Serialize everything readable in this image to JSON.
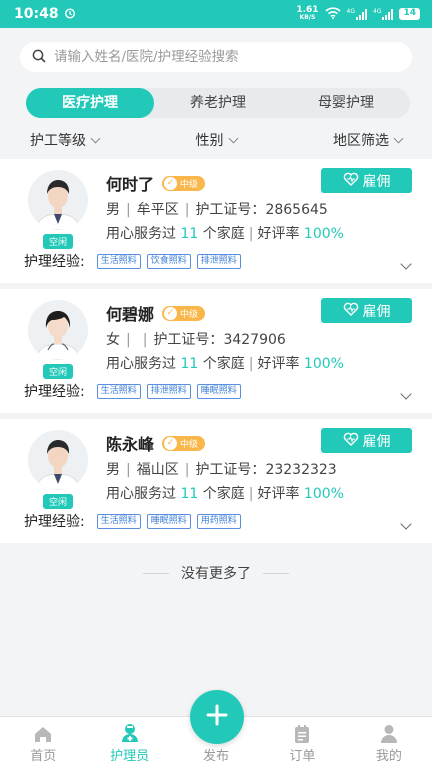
{
  "status": {
    "time": "10:48",
    "speed_value": "1.61",
    "speed_unit": "KB/S",
    "network": "4G",
    "battery": "14"
  },
  "search": {
    "placeholder": "请输入姓名/医院/护理经验搜索"
  },
  "tabs": [
    {
      "label": "医疗护理"
    },
    {
      "label": "养老护理"
    },
    {
      "label": "母婴护理"
    }
  ],
  "filters": [
    {
      "label": "护工等级"
    },
    {
      "label": "性别"
    },
    {
      "label": "地区筛选"
    }
  ],
  "card_common": {
    "idle_label": "空闲",
    "hire_label": "雇佣",
    "level_label": "中级",
    "license_label": "护工证号：",
    "stats_prefix": "用心服务过",
    "stats_families_suffix": "个家庭",
    "rating_label": "好评率",
    "experience_label": "护理经验:"
  },
  "caregivers": [
    {
      "name": "何时了",
      "gender": "男",
      "district": "牟平区",
      "license": "2865645",
      "families": "11",
      "rating": "100%",
      "tags": [
        "生活照料",
        "饮食照料",
        "排泄照料"
      ],
      "colors": {
        "hair": "#2a2a2a",
        "skin": "#f3d6c2"
      }
    },
    {
      "name": "何碧娜",
      "gender": "女",
      "district": "",
      "license": "3427906",
      "families": "11",
      "rating": "100%",
      "tags": [
        "生活照料",
        "排泄照料",
        "睡眠照料"
      ],
      "colors": {
        "hair": "#1e1e1e",
        "skin": "#f5dbc9"
      }
    },
    {
      "name": "陈永峰",
      "gender": "男",
      "district": "福山区",
      "license": "23232323",
      "families": "11",
      "rating": "100%",
      "tags": [
        "生活照料",
        "睡眠照料",
        "用药照料"
      ],
      "colors": {
        "hair": "#2a2a2a",
        "skin": "#f3d6c2"
      }
    }
  ],
  "footer": {
    "no_more": "没有更多了"
  },
  "tabbar": [
    {
      "label": "首页"
    },
    {
      "label": "护理员"
    },
    {
      "label": "发布"
    },
    {
      "label": "订单"
    },
    {
      "label": "我的"
    }
  ],
  "colors": {
    "accent": "#22c9b8",
    "level": "#f9b64a",
    "tag": "#3f7fd8"
  }
}
